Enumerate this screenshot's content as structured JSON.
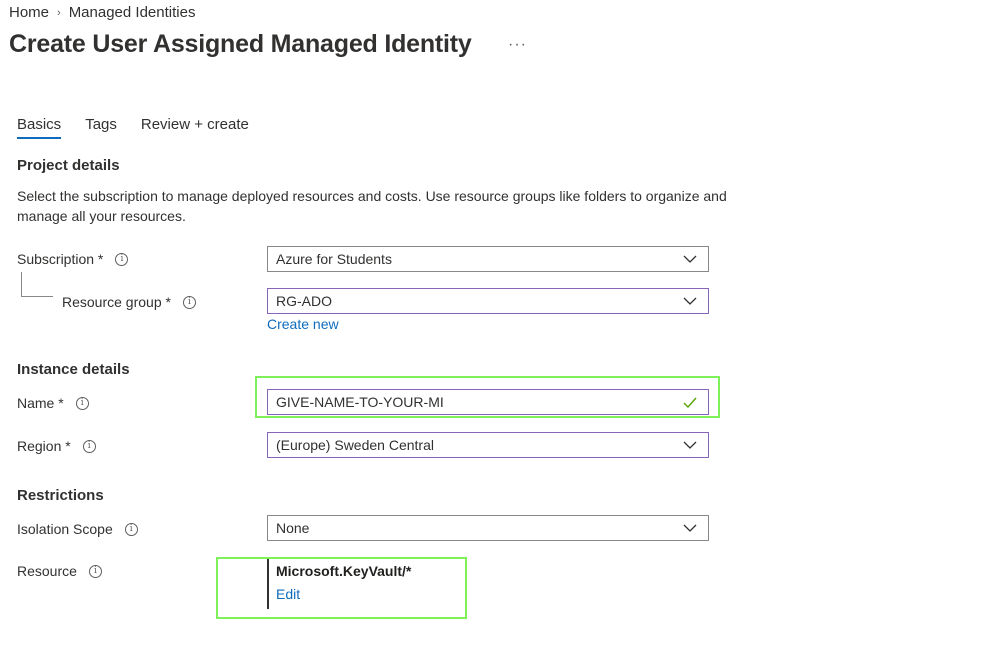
{
  "breadcrumb": {
    "home": "Home",
    "separator": "›",
    "current": "Managed Identities"
  },
  "header": {
    "title": "Create User Assigned Managed Identity",
    "more": "···"
  },
  "tabs": [
    {
      "label": "Basics",
      "active": true
    },
    {
      "label": "Tags",
      "active": false
    },
    {
      "label": "Review + create",
      "active": false
    }
  ],
  "project": {
    "heading": "Project details",
    "description": "Select the subscription to manage deployed resources and costs. Use resource groups like folders to organize and manage all your resources.",
    "subscription": {
      "label": "Subscription *",
      "value": "Azure for Students"
    },
    "resource_group": {
      "label": "Resource group *",
      "value": "RG-ADO",
      "create_new": "Create new"
    }
  },
  "instance": {
    "heading": "Instance details",
    "name": {
      "label": "Name *",
      "value": "GIVE-NAME-TO-YOUR-MI"
    },
    "region": {
      "label": "Region *",
      "value": "(Europe) Sweden Central"
    }
  },
  "restrictions": {
    "heading": "Restrictions",
    "isolation": {
      "label": "Isolation Scope",
      "value": "None"
    },
    "resource": {
      "label": "Resource",
      "value": "Microsoft.KeyVault/*",
      "edit": "Edit"
    }
  },
  "icons": {
    "info": "i",
    "chevron": "chevron-down-icon",
    "check": "checkmark-icon"
  },
  "colors": {
    "accent": "#0f6cbd",
    "highlight": "#7ef05a",
    "focus_border": "#8764b8",
    "check": "#57a300"
  }
}
